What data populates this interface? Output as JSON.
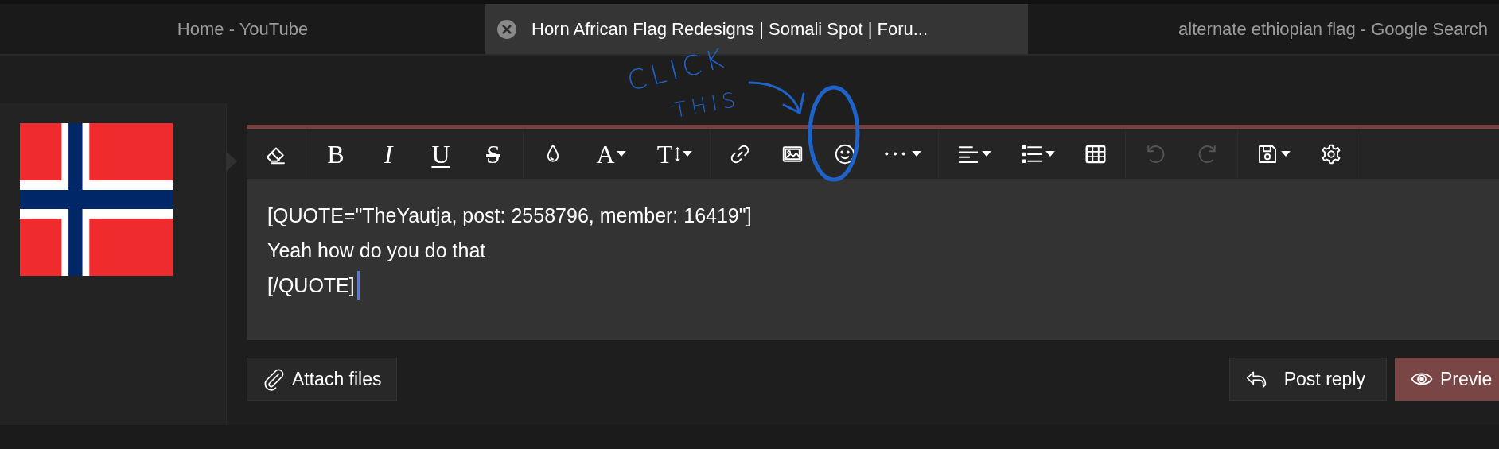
{
  "browser_tabs": [
    {
      "title": "Home - YouTube",
      "selected": false
    },
    {
      "title": "Horn African Flag Redesigns | Somali Spot | Foru...",
      "selected": true
    },
    {
      "title": "alternate ethiopian flag - Google Search",
      "selected": false
    }
  ],
  "toolbar": {
    "groups": [
      [
        {
          "kind": "eraser",
          "disabled": false,
          "dropdown": false
        }
      ],
      [
        {
          "kind": "bold",
          "glyph": "B",
          "disabled": false,
          "dropdown": false
        },
        {
          "kind": "italic",
          "glyph": "I",
          "disabled": false,
          "dropdown": false
        },
        {
          "kind": "underline",
          "glyph": "U",
          "disabled": false,
          "dropdown": false
        },
        {
          "kind": "strike",
          "glyph": "S",
          "disabled": false,
          "dropdown": false
        }
      ],
      [
        {
          "kind": "color",
          "disabled": false,
          "dropdown": false
        },
        {
          "kind": "font",
          "glyph": "A",
          "disabled": false,
          "dropdown": true
        },
        {
          "kind": "size",
          "glyph": "T",
          "disabled": false,
          "dropdown": true
        }
      ],
      [
        {
          "kind": "link",
          "disabled": false,
          "dropdown": false
        },
        {
          "kind": "image",
          "disabled": false,
          "dropdown": false
        },
        {
          "kind": "smilie",
          "disabled": false,
          "dropdown": false
        },
        {
          "kind": "more",
          "disabled": false,
          "dropdown": true
        }
      ],
      [
        {
          "kind": "align",
          "disabled": false,
          "dropdown": true
        },
        {
          "kind": "list",
          "disabled": false,
          "dropdown": true
        },
        {
          "kind": "table",
          "disabled": false,
          "dropdown": false
        }
      ],
      [
        {
          "kind": "undo",
          "disabled": true,
          "dropdown": false
        },
        {
          "kind": "redo",
          "disabled": true,
          "dropdown": false
        }
      ],
      [
        {
          "kind": "save",
          "disabled": false,
          "dropdown": true
        },
        {
          "kind": "settings",
          "disabled": false,
          "dropdown": false
        }
      ]
    ]
  },
  "editor": {
    "lines": [
      "[QUOTE=\"TheYautja, post: 2558796, member: 16419\"]",
      "Yeah how do you do that",
      "[/QUOTE]"
    ]
  },
  "buttons": [
    {
      "label": "Attach files",
      "kind": "attach"
    },
    {
      "label": "Post reply",
      "kind": "reply"
    },
    {
      "label": "Previe",
      "kind": "preview"
    }
  ],
  "annotation": {
    "lines": [
      "CLICK",
      "THIS"
    ]
  }
}
